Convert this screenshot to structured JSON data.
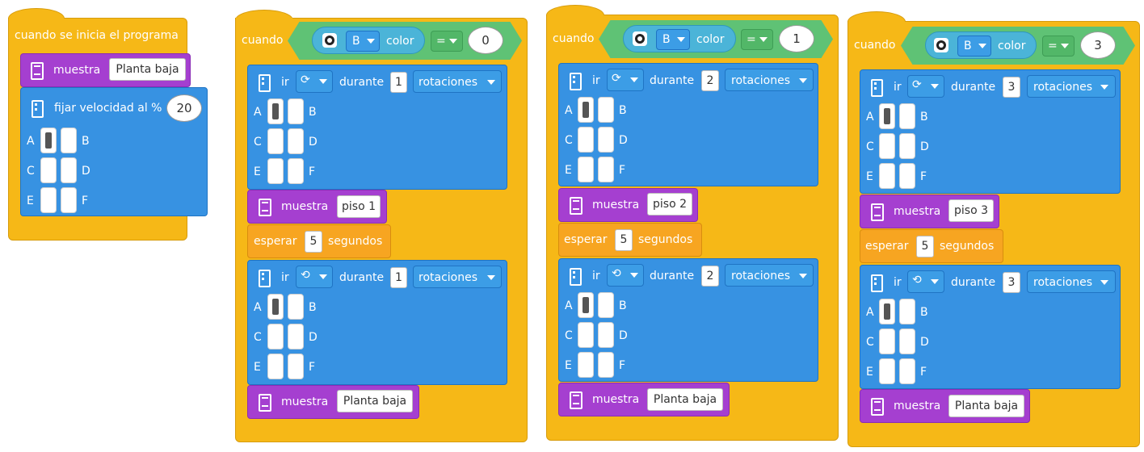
{
  "start_script": {
    "hat_label": "cuando se inicia el programa",
    "display_label": "muestra",
    "display_value": "Planta baja",
    "speed_label": "fijar velocidad al %",
    "speed_value": "20",
    "ports": {
      "a": "A",
      "b": "B",
      "c": "C",
      "d": "D",
      "e": "E",
      "f": "F"
    }
  },
  "color_scripts": [
    {
      "hat_label": "cuando",
      "sensor_port": "B",
      "sensor_label": "color",
      "operator": "=",
      "value": "0",
      "move1": {
        "go": "ir",
        "during": "durante",
        "amount": "1",
        "unit": "rotaciones"
      },
      "ports": {
        "a": "A",
        "b": "B",
        "c": "C",
        "d": "D",
        "e": "E",
        "f": "F"
      },
      "show1": {
        "label": "muestra",
        "value": "piso 1"
      },
      "wait": {
        "label": "esperar",
        "amount": "5",
        "unit": "segundos"
      },
      "move2": {
        "go": "ir",
        "during": "durante",
        "amount": "1",
        "unit": "rotaciones"
      },
      "show2": {
        "label": "muestra",
        "value": "Planta baja"
      }
    },
    {
      "hat_label": "cuando",
      "sensor_port": "B",
      "sensor_label": "color",
      "operator": "=",
      "value": "1",
      "move1": {
        "go": "ir",
        "during": "durante",
        "amount": "2",
        "unit": "rotaciones"
      },
      "ports": {
        "a": "A",
        "b": "B",
        "c": "C",
        "d": "D",
        "e": "E",
        "f": "F"
      },
      "show1": {
        "label": "muestra",
        "value": "piso 2"
      },
      "wait": {
        "label": "esperar",
        "amount": "5",
        "unit": "segundos"
      },
      "move2": {
        "go": "ir",
        "during": "durante",
        "amount": "2",
        "unit": "rotaciones"
      },
      "show2": {
        "label": "muestra",
        "value": "Planta baja"
      }
    },
    {
      "hat_label": "cuando",
      "sensor_port": "B",
      "sensor_label": "color",
      "operator": "=",
      "value": "3",
      "move1": {
        "go": "ir",
        "during": "durante",
        "amount": "3",
        "unit": "rotaciones"
      },
      "ports": {
        "a": "A",
        "b": "B",
        "c": "C",
        "d": "D",
        "e": "E",
        "f": "F"
      },
      "show1": {
        "label": "muestra",
        "value": "piso 3"
      },
      "wait": {
        "label": "esperar",
        "amount": "5",
        "unit": "segundos"
      },
      "move2": {
        "go": "ir",
        "during": "durante",
        "amount": "3",
        "unit": "rotaciones"
      },
      "show2": {
        "label": "muestra",
        "value": "Planta baja"
      }
    }
  ],
  "icons": {
    "motor": "motor-icon",
    "display": "display-icon",
    "color_sensor": "color-sensor-icon",
    "clockwise": "clockwise-icon",
    "counterclockwise": "counterclockwise-icon",
    "dropdown": "dropdown-caret-icon"
  },
  "colors": {
    "events": "#f6b817",
    "motors": "#3792e2",
    "display": "#a53fd0",
    "control": "#f7a521",
    "sensor": "#4bb4d8",
    "operator": "#5fc275"
  }
}
